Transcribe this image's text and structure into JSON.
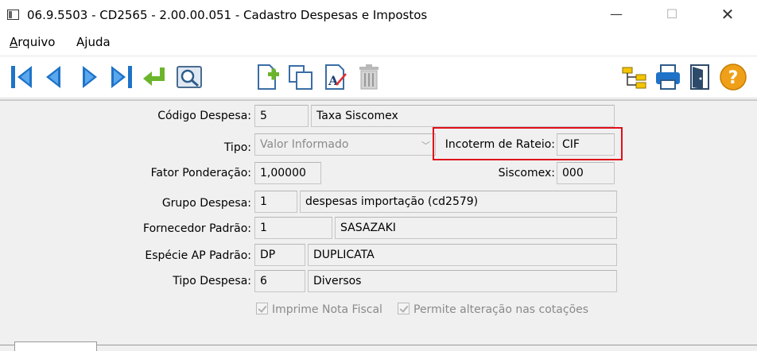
{
  "window": {
    "title": "06.9.5503 - CD2565 - 2.00.00.051 - Cadastro Despesas e Impostos",
    "minimize_glyph": "—",
    "maximize_glyph": "☐",
    "close_glyph": "✕"
  },
  "menu": {
    "items": [
      {
        "accel": "A",
        "rest": "rquivo"
      },
      {
        "accel": "j",
        "pre": "A",
        "rest": "uda"
      }
    ]
  },
  "toolbar": {
    "buttons": [
      "first-record-icon",
      "previous-record-icon",
      "next-record-icon",
      "last-record-icon",
      "return-icon",
      "search-icon",
      "new-record-icon",
      "copy-record-icon",
      "edit-record-icon",
      "delete-record-icon",
      "tree-icon",
      "print-icon",
      "exit-icon",
      "help-icon"
    ],
    "colors": {
      "nav_blue": "#1e73c8",
      "return_green": "#6bb52a",
      "help_orange": "#f0a018"
    }
  },
  "form": {
    "codigo_despesa": {
      "label": "Código Despesa:",
      "code": "5",
      "desc": "Taxa Siscomex"
    },
    "tipo": {
      "label": "Tipo:",
      "value": "Valor Informado"
    },
    "incoterm": {
      "label": "Incoterm de Rateio:",
      "value": "CIF"
    },
    "fator": {
      "label": "Fator Ponderação:",
      "value": "1,00000"
    },
    "siscomex": {
      "label": "Siscomex:",
      "value": "000"
    },
    "grupo": {
      "label": "Grupo Despesa:",
      "code": "1",
      "desc": "despesas importação (cd2579)"
    },
    "fornecedor": {
      "label": "Fornecedor Padrão:",
      "code": "1",
      "desc": "SASAZAKI"
    },
    "especie": {
      "label": "Espécie AP Padrão:",
      "code": "DP",
      "desc": "DUPLICATA"
    },
    "tipo_despesa": {
      "label": "Tipo Despesa:",
      "code": "6",
      "desc": "Diversos"
    },
    "imprime_nf": {
      "label": "Imprime Nota Fiscal",
      "checked": true
    },
    "permite_alt": {
      "label": "Permite alteração nas cotações",
      "checked": true
    }
  },
  "highlight_color": "#e0101a"
}
